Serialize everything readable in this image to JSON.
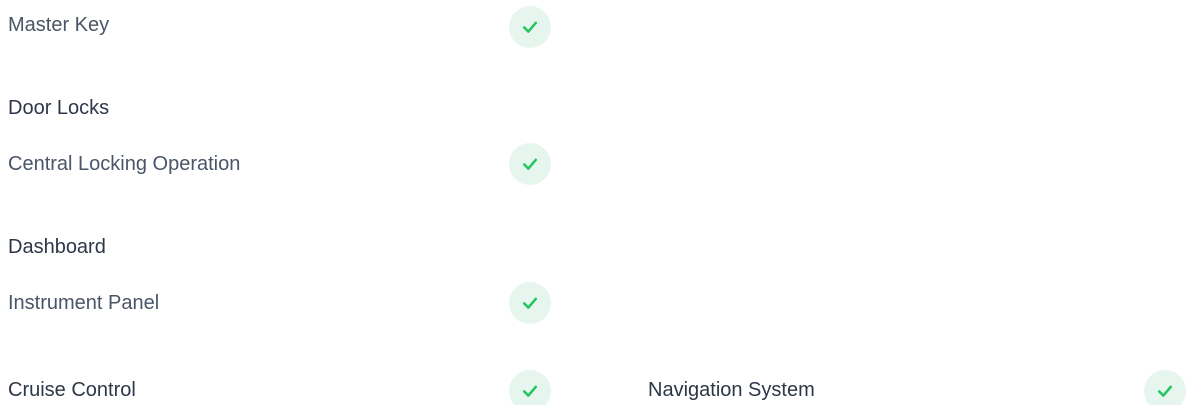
{
  "checklist": {
    "master_key": {
      "label": "Master Key",
      "status_icon": "check-icon",
      "checked": true
    },
    "door_locks": {
      "heading": "Door Locks"
    },
    "central_locking_operation": {
      "label": "Central Locking Operation",
      "status_icon": "check-icon",
      "checked": true
    },
    "dashboard": {
      "heading": "Dashboard"
    },
    "instrument_panel": {
      "label": "Instrument Panel",
      "status_icon": "check-icon",
      "checked": true
    },
    "cruise_control": {
      "label": "Cruise Control",
      "status_icon": "check-icon",
      "checked": true
    },
    "navigation_system": {
      "label": "Navigation System",
      "status_icon": "check-icon",
      "checked": true
    }
  },
  "colors": {
    "check_stroke": "#22c55e",
    "check_bg": "#e6f6ee",
    "item_text": "#4a5568",
    "heading_text": "#2d3748"
  }
}
